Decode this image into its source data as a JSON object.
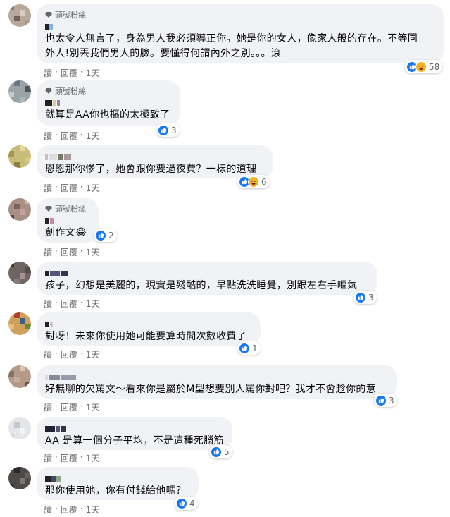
{
  "comments": [
    {
      "fan_label": "頭號粉絲",
      "text": "也太令人無言了，身為男人我必須導正你。她是你的女人，像家人般的存在。不等同\n外人!別丟我們男人的臉。要懂得何謂內外之別。。。滾",
      "reaction_count": "58",
      "reactions": [
        "like",
        "haha"
      ],
      "actions": {
        "reply": "讀",
        "reply_label": "回覆",
        "time": "1天"
      }
    },
    {
      "fan_label": "頭號粉絲",
      "text": "就算是AA你也摳的太極致了",
      "reaction_count": "3",
      "reactions": [
        "like"
      ],
      "actions": {
        "reply": "讀",
        "reply_label": "回覆",
        "time": "1天"
      }
    },
    {
      "fan_label": "",
      "text": "恩恩那你慘了，她會跟你要過夜費？一樣的道理",
      "reaction_count": "6",
      "reactions": [
        "like",
        "haha"
      ],
      "actions": {
        "reply": "讀",
        "reply_label": "回覆",
        "time": "1天"
      }
    },
    {
      "fan_label": "頭號粉絲",
      "text": "創作文😂",
      "reaction_count": "2",
      "reactions": [
        "like"
      ],
      "actions": {
        "reply": "讀",
        "reply_label": "回覆",
        "time": "1天"
      }
    },
    {
      "fan_label": "",
      "text": "孩子，幻想是美麗的，現實是殘酷的，早點洗洗睡覺，別跟左右手嘔氣",
      "reaction_count": "3",
      "reactions": [
        "like"
      ],
      "actions": {
        "reply": "讀",
        "reply_label": "回覆",
        "time": "1天"
      }
    },
    {
      "fan_label": "",
      "text": "對呀！未來你使用她可能要算時間次數收費了",
      "reaction_count": "1",
      "reactions": [
        "like"
      ],
      "actions": {
        "reply": "讀",
        "reply_label": "回覆",
        "time": "1天"
      }
    },
    {
      "fan_label": "",
      "text": "好無聊的欠罵文～看來你是屬於M型想要別人罵你對吧？我才不會趁你的意",
      "reaction_count": "3",
      "reactions": [
        "like"
      ],
      "actions": {
        "reply": "讀",
        "reply_label": "回覆",
        "time": "1天"
      }
    },
    {
      "fan_label": "",
      "text": "AA 是算一個分子平均，不是這種死腦筋",
      "reaction_count": "5",
      "reactions": [
        "like"
      ],
      "actions": {
        "reply": "讀",
        "reply_label": "回覆",
        "time": "1天"
      }
    },
    {
      "fan_label": "",
      "text": "那你使用她，你有付錢給他嗎？",
      "reaction_count": "4",
      "reactions": [
        "like"
      ],
      "actions": {
        "reply": "讀",
        "reply_label": "回覆",
        "time": "1天"
      }
    }
  ],
  "colors": {
    "bubble": "#f0f2f5",
    "meta": "#65676b",
    "like": "#1877f2",
    "haha": "#f7b125"
  }
}
